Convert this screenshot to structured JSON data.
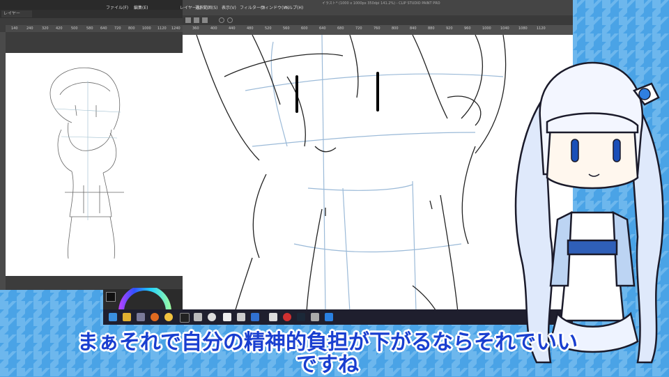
{
  "app": {
    "title": "イラスト* (1000 x 1000px 350dpi 141.2%) - CLIP STUDIO PAINT PRO",
    "menu": [
      "ファイル(F)",
      "編集(E)",
      "レイヤー(L)",
      "選択範囲(S)",
      "表示(V)",
      "フィルター(I)",
      "ウィンドウ(W)",
      "ヘルプ(H)"
    ],
    "ruler_ticks": [
      "360",
      "400",
      "440",
      "480",
      "520",
      "560",
      "600",
      "640",
      "680",
      "720",
      "760",
      "800",
      "840",
      "880",
      "920",
      "960",
      "1000",
      "1040",
      "1080",
      "1120"
    ]
  },
  "navigator": {
    "tab_label": "レイヤー",
    "ruler_ticks": [
      "140",
      "240",
      "320",
      "420",
      "500",
      "580",
      "640",
      "720",
      "800",
      "1000",
      "1120",
      "1240"
    ]
  },
  "subtitle": {
    "line1": "まぁそれで自分の精神的負担が下がるならそれでいい",
    "line2": "ですね"
  },
  "colors": {
    "background": "#4da6e8",
    "subtitle_text": "#1a3fd0",
    "subtitle_outline": "#ffffff"
  }
}
